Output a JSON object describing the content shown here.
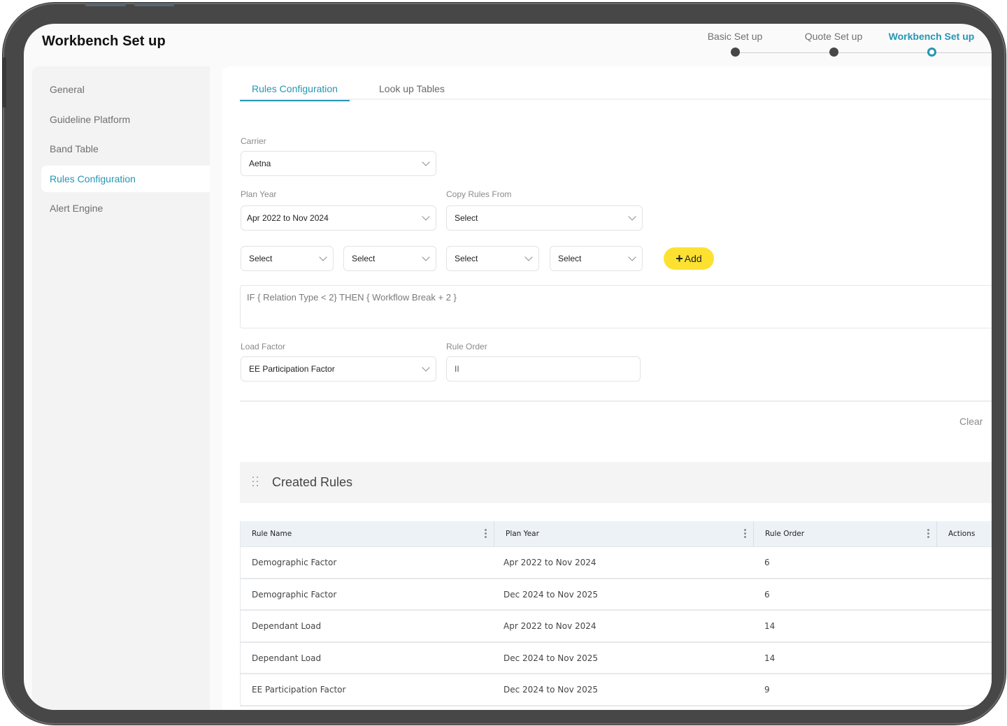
{
  "app": {
    "title": "Workbench Set up"
  },
  "stepper": {
    "steps": [
      {
        "label": "Basic Set up",
        "state": "complete"
      },
      {
        "label": "Quote Set up",
        "state": "complete"
      },
      {
        "label": "Workbench Set up",
        "state": "active"
      }
    ],
    "accent_color": "#2596b3"
  },
  "sidebar": {
    "items": [
      {
        "label": "General",
        "active": false
      },
      {
        "label": "Guideline Platform",
        "active": false
      },
      {
        "label": "Band Table",
        "active": false
      },
      {
        "label": "Rules Configuration",
        "active": true
      },
      {
        "label": "Alert Engine",
        "active": false
      }
    ]
  },
  "tabs": [
    {
      "label": "Rules Configuration",
      "active": true
    },
    {
      "label": "Look up Tables",
      "active": false
    }
  ],
  "form": {
    "carrier": {
      "label": "Carrier",
      "value": "Aetna"
    },
    "plan_year": {
      "label": "Plan Year",
      "value": "Apr 2022 to Nov 2024"
    },
    "copy_rules_from": {
      "label": "Copy Rules From",
      "value": "Select"
    },
    "condition_selects": [
      "Select",
      "Select",
      "Select",
      "Select"
    ],
    "add_button": {
      "icon": "plus-icon",
      "label": "Add",
      "color": "#fde131"
    },
    "rule_expression": "IF { Relation Type < 2} THEN { Workflow Break + 2 }",
    "load_factor": {
      "label": "Load Factor",
      "value": "EE Participation Factor"
    },
    "rule_order": {
      "label": "Rule Order",
      "value": "II"
    },
    "clear_label": "Clear"
  },
  "created_rules": {
    "title": "Created Rules",
    "columns": [
      "Rule Name",
      "Plan Year",
      "Rule Order",
      "Actions"
    ],
    "rows": [
      {
        "rule_name": "Demographic Factor",
        "plan_year": "Apr 2022 to Nov 2024",
        "rule_order": "6"
      },
      {
        "rule_name": "Demographic Factor",
        "plan_year": "Dec 2024 to Nov 2025",
        "rule_order": "6"
      },
      {
        "rule_name": "Dependant Load",
        "plan_year": "Apr 2022 to Nov 2024",
        "rule_order": "14"
      },
      {
        "rule_name": "Dependant Load",
        "plan_year": "Dec 2024 to Nov 2025",
        "rule_order": "14"
      },
      {
        "rule_name": "EE Participation Factor",
        "plan_year": "Dec 2024 to Nov 2025",
        "rule_order": "9"
      }
    ]
  }
}
